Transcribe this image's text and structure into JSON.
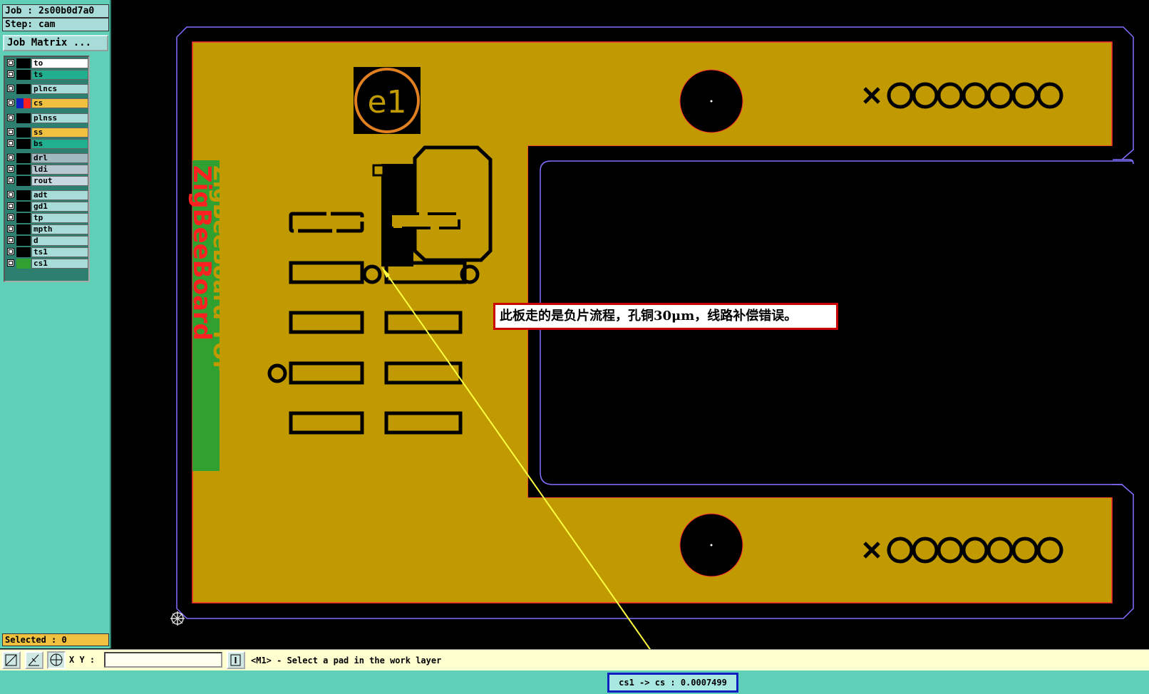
{
  "header": {
    "job_label": "Job : 2s00b0d7a0",
    "step_label": "Step: cam",
    "job_matrix_button": "Job Matrix ..."
  },
  "layers": [
    {
      "name": "to",
      "bg": "#ffffff",
      "swatch": "#000000"
    },
    {
      "name": "ts",
      "bg": "#20b090",
      "swatch": "#000000"
    },
    {
      "name": "plncs",
      "bg": "#a8dcd8",
      "swatch": "#000000"
    },
    {
      "name": "cs",
      "bg": "#f0c040",
      "swatch": "#ff2020",
      "swatch_left": "#1020c0",
      "active": true
    },
    {
      "name": "plnss",
      "bg": "#a8dcd8",
      "swatch": "#000000"
    },
    {
      "name": "ss",
      "bg": "#f0c040",
      "swatch": "#000000"
    },
    {
      "name": "bs",
      "bg": "#20b090",
      "swatch": "#000000"
    },
    {
      "name": "drl",
      "bg": "#a0b8c0",
      "swatch": "#000000"
    },
    {
      "name": "ldi",
      "bg": "#b8c8d0",
      "swatch": "#000000"
    },
    {
      "name": "rout",
      "bg": "#c8d8e0",
      "swatch": "#000000"
    },
    {
      "name": "adt",
      "bg": "#a8dcd8",
      "swatch": "#000000"
    },
    {
      "name": "gd1",
      "bg": "#a8dcd8",
      "swatch": "#000000"
    },
    {
      "name": "tp",
      "bg": "#a8dcd8",
      "swatch": "#000000"
    },
    {
      "name": "mpth",
      "bg": "#a8dcd8",
      "swatch": "#000000"
    },
    {
      "name": "d",
      "bg": "#a8dcd8",
      "swatch": "#000000"
    },
    {
      "name": "ts1",
      "bg": "#a8dcd8",
      "swatch": "#000000"
    },
    {
      "name": "cs1",
      "bg": "#a8dcd8",
      "swatch": "#30a030"
    }
  ],
  "selected_label": "Selected : 0",
  "toolbar": {
    "xy_label": "X Y :",
    "xy_value": "",
    "message": "<M1> - Select a pad in the work layer"
  },
  "status": {
    "readout": "cs1 -> cs : 0.0007499"
  },
  "board": {
    "marker_text": "e1",
    "silkscreen_text_1": "ZigBeeBoard",
    "silkscreen_text_2": "ZigBeeBoard TOP",
    "annotation": "此板走的是负片流程，孔铜30μm，线路补偿错误。"
  },
  "colors": {
    "copper": "#c09a00",
    "background": "#000000",
    "outline": "#8070ff",
    "pad_edge": "#ff3030",
    "panel": "#5fcfb8",
    "arrow": "#ffff40"
  }
}
